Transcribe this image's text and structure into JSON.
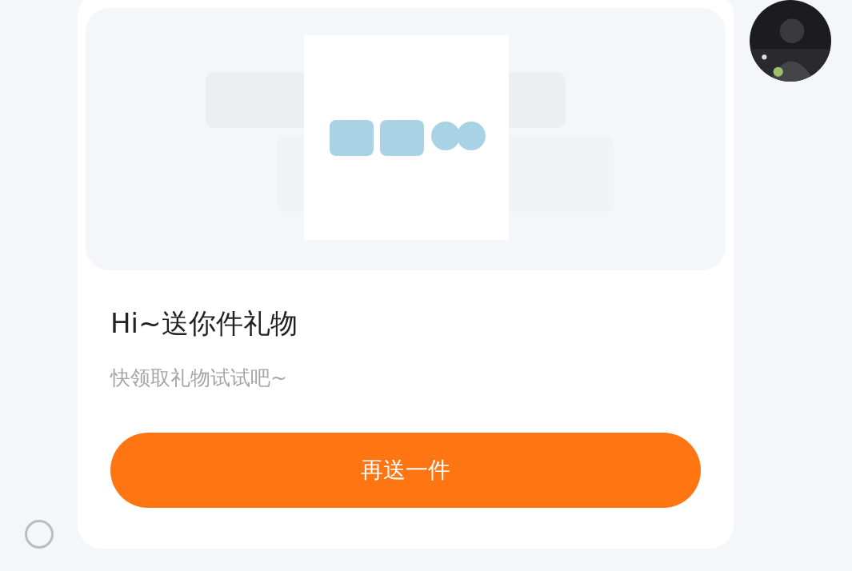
{
  "message": {
    "select_circle": {
      "selected": false
    },
    "gift_card": {
      "title": "Hi~送你件礼物",
      "subtitle": "快领取礼物试试吧~",
      "button": "再送一件"
    }
  }
}
